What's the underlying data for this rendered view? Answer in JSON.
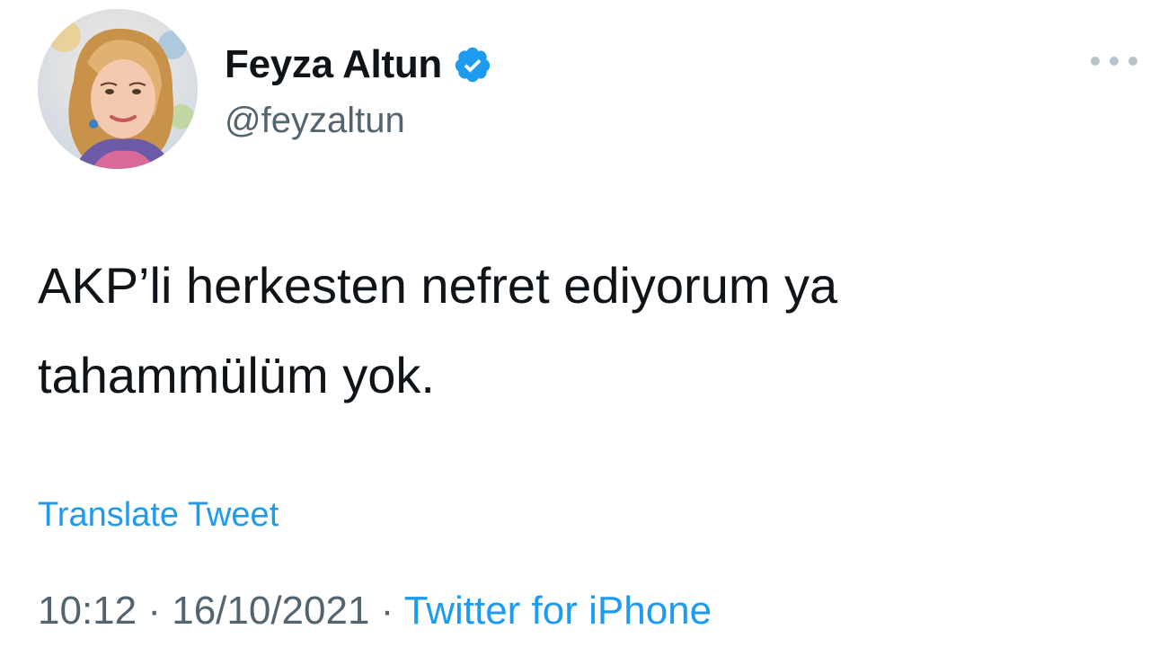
{
  "author": {
    "display_name": "Feyza Altun",
    "handle": "@feyzaltun",
    "verified": true,
    "avatar_icon": "profile-photo"
  },
  "actions": {
    "more_icon": "more-horizontal-icon"
  },
  "tweet": {
    "text": "AKP’li herkesten nefret ediyorum ya\ntahammülüm yok.",
    "translate_label": "Translate Tweet",
    "time": "10:12",
    "separator": " · ",
    "date": "16/10/2021",
    "source": "Twitter for iPhone"
  },
  "colors": {
    "link": "#1d9bf0",
    "secondary_text": "#536471",
    "primary_text": "#0f1419",
    "verified_badge": "#1d9bf0"
  }
}
